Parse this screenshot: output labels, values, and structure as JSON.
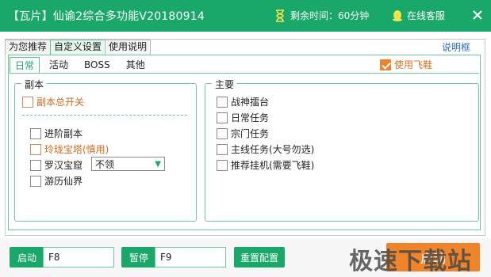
{
  "titlebar": {
    "title": "【瓦片】仙谕2综合多功能V20180914",
    "timer": "剩余时间：60分钟",
    "service": "在线客服",
    "bg_color": "#1aa86a"
  },
  "top_tabs": [
    "为您推荐",
    "自定义设置",
    "使用说明"
  ],
  "help_box": "说明框",
  "sub_tabs": [
    "日常",
    "活动",
    "BOSS",
    "其他"
  ],
  "flying_shoe": {
    "label": "使用飞鞋",
    "checked": true
  },
  "fuben": {
    "legend": "副本",
    "master": "副本总开关",
    "items": [
      "进阶副本",
      "玲珑宝塔(慎用)",
      "罗汉宝窟",
      "游历仙界"
    ],
    "dropdown_value": "不领"
  },
  "zhuyao": {
    "legend": "主要",
    "items": [
      "战神擂台",
      "日常任务",
      "宗门任务",
      "主线任务(大号勿选)",
      "推荐挂机(需要飞鞋)"
    ]
  },
  "bottom": {
    "start_label": "启动",
    "start_key": "F8",
    "pause_label": "暂停",
    "pause_key": "F9",
    "reset_label": "重置配置",
    "main_start": "启动",
    "watermark": "极速下载站"
  }
}
